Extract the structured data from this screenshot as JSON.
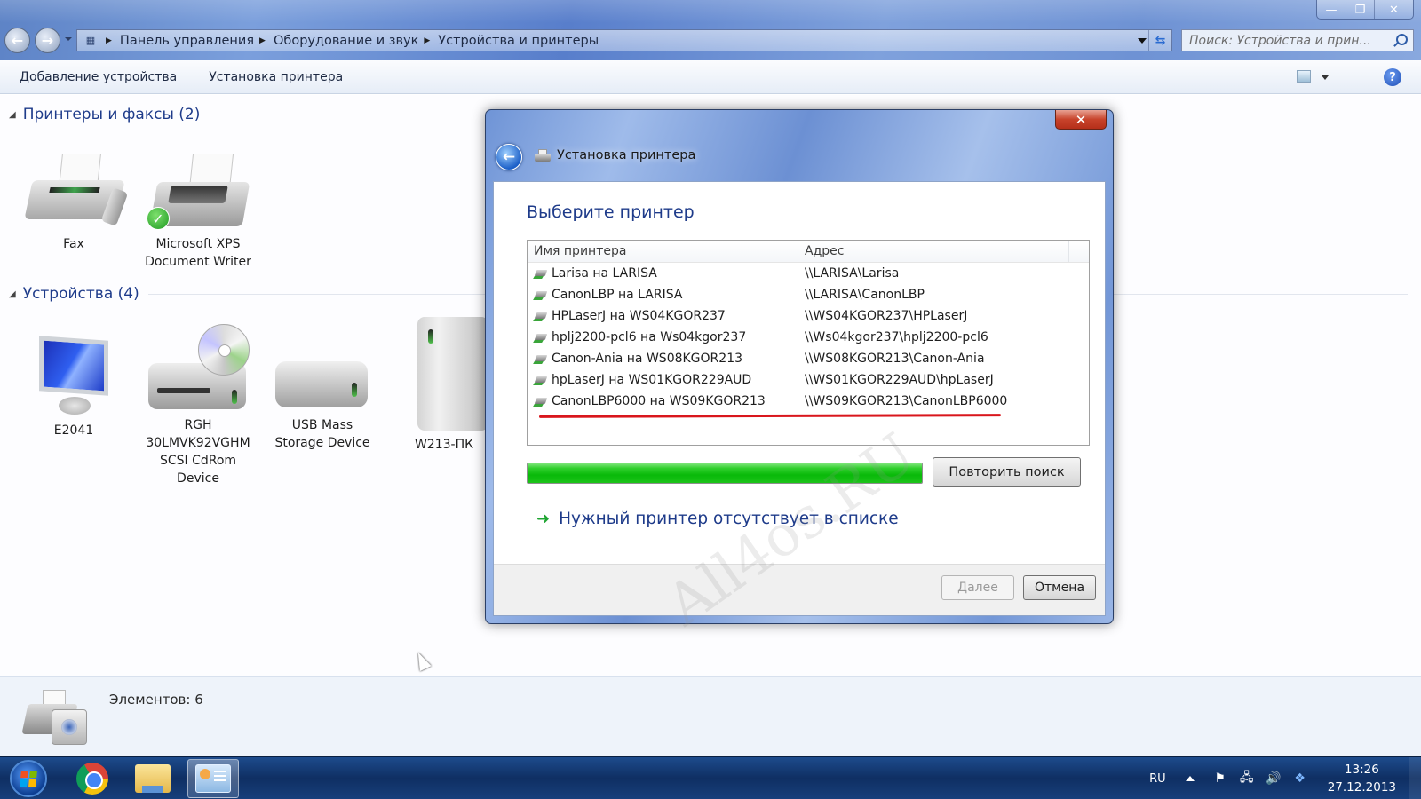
{
  "explorer": {
    "window_controls": {
      "minimize": "—",
      "maximize": "❐",
      "close": "✕"
    },
    "nav": {
      "back_icon": "back-arrow-icon",
      "forward_icon": "forward-arrow-icon"
    },
    "breadcrumb": [
      "Панель управления",
      "Оборудование и звук",
      "Устройства и принтеры"
    ],
    "search": {
      "placeholder": "Поиск: Устройства и прин..."
    },
    "commands": [
      "Добавление устройства",
      "Установка принтера"
    ],
    "groups": [
      {
        "title": "Принтеры и факсы (2)",
        "items": [
          {
            "label": "Fax",
            "icon": "fax-icon"
          },
          {
            "label": "Microsoft XPS Document Writer",
            "icon": "printer-icon",
            "default": true
          }
        ]
      },
      {
        "title": "Устройства (4)",
        "items": [
          {
            "label": "E2041",
            "icon": "monitor-icon"
          },
          {
            "label": "RGH 30LMVK92VGHM SCSI CdRom Device",
            "icon": "cdrom-icon"
          },
          {
            "label": "USB Mass Storage Device",
            "icon": "hdd-icon"
          },
          {
            "label": "W213-ПК",
            "icon": "computer-icon"
          }
        ]
      }
    ],
    "status": {
      "count_text": "Элементов: 6"
    }
  },
  "dialog": {
    "title": "Установка принтера",
    "close": "✕",
    "heading": "Выберите принтер",
    "columns": [
      "Имя принтера",
      "Адрес"
    ],
    "printers": [
      {
        "name": "Larisa на LARISA",
        "address": "\\\\LARISA\\Larisa"
      },
      {
        "name": "CanonLBP на LARISA",
        "address": "\\\\LARISA\\CanonLBP"
      },
      {
        "name": "HPLaserJ на WS04KGOR237",
        "address": "\\\\WS04KGOR237\\HPLaserJ"
      },
      {
        "name": "hplj2200-pcl6 на Ws04kgor237",
        "address": "\\\\Ws04kgor237\\hplj2200-pcl6"
      },
      {
        "name": "Canon-Ania на WS08KGOR213",
        "address": "\\\\WS08KGOR213\\Canon-Ania"
      },
      {
        "name": "hpLaserJ на WS01KGOR229AUD",
        "address": "\\\\WS01KGOR229AUD\\hpLaserJ"
      },
      {
        "name": "CanonLBP6000 на WS09KGOR213",
        "address": "\\\\WS09KGOR213\\CanonLBP6000",
        "highlighted": true
      }
    ],
    "search_progress_percent": 100,
    "retry_label": "Повторить поиск",
    "missing_link": "Нужный принтер отсутствует в списке",
    "next_label": "Далее",
    "cancel_label": "Отмена",
    "highlight_color": "#d9161c",
    "progress_color": "#09b909"
  },
  "watermark": "All4os.RU",
  "taskbar": {
    "pinned": [
      "start-button",
      "chrome",
      "windows-explorer",
      "control-panel"
    ],
    "tray": {
      "language": "RU",
      "time": "13:26",
      "date": "27.12.2013"
    }
  }
}
